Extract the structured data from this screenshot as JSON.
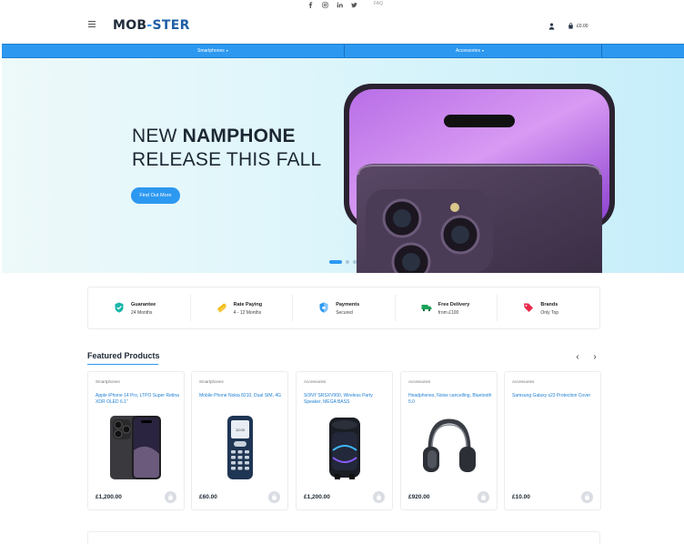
{
  "topbar": {
    "social_icons": [
      "facebook-icon",
      "instagram-icon",
      "linkedin-icon",
      "twitter-icon"
    ],
    "faq": "FAQ"
  },
  "header": {
    "logo_part1": "MOB",
    "logo_dash": "-",
    "logo_part2": "STER",
    "cart_total": "£0.00"
  },
  "nav": {
    "items": [
      {
        "label": "Smartphones"
      },
      {
        "label": "Accessories"
      }
    ]
  },
  "hero": {
    "line1_prefix": "NEW ",
    "line1_bold": "NAMPHONE",
    "line2": "RELEASE THIS FALL",
    "button": "Find Out More",
    "slides": 3,
    "active_slide": 1
  },
  "features": [
    {
      "title": "Guarantee",
      "subtitle": "24 Months",
      "icon": "shield-check-icon",
      "color": "#1bb6a9"
    },
    {
      "title": "Rate Paying",
      "subtitle": "4 - 12 Months",
      "icon": "card-stack-icon",
      "color": "#f2b705"
    },
    {
      "title": "Payments",
      "subtitle": "Secured",
      "icon": "shield-lock-icon",
      "color": "#2c98f0"
    },
    {
      "title": "Free Delivery",
      "subtitle": "from £100",
      "icon": "truck-icon",
      "color": "#18a35a"
    },
    {
      "title": "Brands",
      "subtitle": "Only Top",
      "icon": "tag-icon",
      "color": "#e8294b"
    }
  ],
  "featured": {
    "title": "Featured Products",
    "products": [
      {
        "category": "Smartphones",
        "name": "Apple iPhone 14 Pro, LTPO Super Retina XDR OLED 6.1\"",
        "price": "£1,200.00",
        "image": "iphone-image"
      },
      {
        "category": "Smartphones",
        "name": "Mobile Phone Nokia 8210, Dual SIM, 4G",
        "price": "£60.00",
        "image": "nokia-image"
      },
      {
        "category": "Accessories",
        "name": "SONY SRSXV900, Wireless Party Speaker, MEGA BASS",
        "price": "£1,200.00",
        "image": "speaker-image"
      },
      {
        "category": "Accessories",
        "name": "Headphones, Noise cancelling, Bluetooth 5.0",
        "price": "£920.00",
        "image": "headphones-image"
      },
      {
        "category": "Accessories",
        "name": "Samsung Galaxy s23 Protection Cover",
        "price": "£10.00",
        "image": ""
      }
    ]
  },
  "colors": {
    "accent": "#2c98f0",
    "dark": "#1c2733",
    "link": "#1f7fd2"
  }
}
